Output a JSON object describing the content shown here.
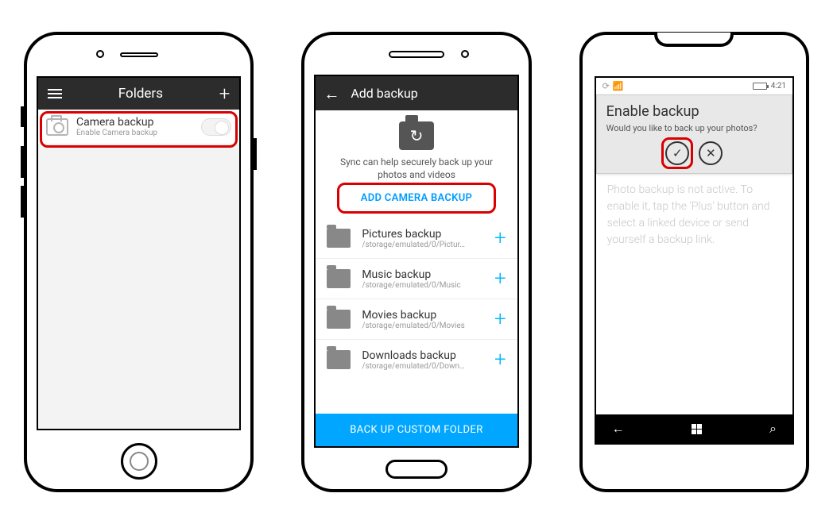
{
  "iphone": {
    "header_title": "Folders",
    "row": {
      "title": "Camera backup",
      "subtitle": "Enable Camera backup"
    }
  },
  "android": {
    "header_title": "Add backup",
    "description": "Sync can help securely back up your photos and videos",
    "add_label": "ADD CAMERA BACKUP",
    "items": [
      {
        "title": "Pictures backup",
        "path": "/storage/emulated/0/Pictur…"
      },
      {
        "title": "Music backup",
        "path": "/storage/emulated/0/Music"
      },
      {
        "title": "Movies backup",
        "path": "/storage/emulated/0/Movies"
      },
      {
        "title": "Downloads backup",
        "path": "/storage/emulated/0/Down…"
      }
    ],
    "footer": "BACK UP CUSTOM FOLDER"
  },
  "windows": {
    "status_time": "4:21",
    "dialog": {
      "title": "Enable backup",
      "prompt": "Would you like to back up your photos?"
    },
    "body": "Photo backup is not active. To enable it, tap the 'Plus' button and select a linked device or send yourself a backup link."
  }
}
